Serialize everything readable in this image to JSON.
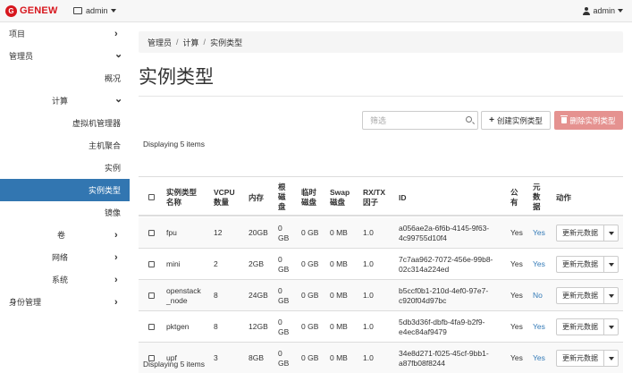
{
  "brand": {
    "name": "GENEW",
    "color": "#d7161d"
  },
  "topbar": {
    "project": "admin",
    "user": "admin"
  },
  "sidebar": {
    "items": [
      {
        "label": "项目",
        "chevron": "›"
      },
      {
        "label": "管理员",
        "chevron": "⌄"
      },
      {
        "label": "概况"
      },
      {
        "label": "计算",
        "chevron": "⌄"
      },
      {
        "label": "虚拟机管理器"
      },
      {
        "label": "主机聚合"
      },
      {
        "label": "实例"
      },
      {
        "label": "实例类型",
        "active": true
      },
      {
        "label": "镜像"
      },
      {
        "label": "卷",
        "chevron": "›"
      },
      {
        "label": "网络",
        "chevron": "›"
      },
      {
        "label": "系统",
        "chevron": "›"
      },
      {
        "label": "身份管理",
        "chevron": "›"
      }
    ]
  },
  "breadcrumb": [
    "管理员",
    "计算",
    "实例类型"
  ],
  "page_title": "实例类型",
  "toolbar": {
    "filter_placeholder": "筛选",
    "create_label": "创建实例类型",
    "delete_label": "删除实例类型"
  },
  "displaying": "Displaying 5 items",
  "table": {
    "columns": {
      "name": [
        "实例类型",
        "名称"
      ],
      "vcpu": [
        "VCPU",
        "数量"
      ],
      "ram": "内存",
      "root": [
        "根",
        "磁",
        "盘"
      ],
      "eph": [
        "临时",
        "磁盘"
      ],
      "swap": [
        "Swap",
        "磁盘"
      ],
      "rxtx": [
        "RX/TX",
        "因子"
      ],
      "id": "ID",
      "public": [
        "公",
        "有"
      ],
      "meta": [
        "元",
        "数",
        "据"
      ],
      "actions": "动作"
    },
    "rows": [
      {
        "name": [
          "fpu"
        ],
        "vcpu": "12",
        "ram": "20GB",
        "root": [
          "0",
          "GB"
        ],
        "eph": "0 GB",
        "swap": "0 MB",
        "rxtx": "1.0",
        "id": [
          "a056ae2a-6f6b-4145-9f63-",
          "4c99755d10f4"
        ],
        "public": "Yes",
        "meta": "Yes",
        "action": "更新元数据"
      },
      {
        "name": [
          "mini"
        ],
        "vcpu": "2",
        "ram": "2GB",
        "root": [
          "0",
          "GB"
        ],
        "eph": "0 GB",
        "swap": "0 MB",
        "rxtx": "1.0",
        "id": [
          "7c7aa962-7072-456e-99b8-",
          "02c314a224ed"
        ],
        "public": "Yes",
        "meta": "Yes",
        "action": "更新元数据"
      },
      {
        "name": [
          "openstack",
          "_node"
        ],
        "vcpu": "8",
        "ram": "24GB",
        "root": [
          "0",
          "GB"
        ],
        "eph": "0 GB",
        "swap": "0 MB",
        "rxtx": "1.0",
        "id": [
          "b5ccf0b1-210d-4ef0-97e7-",
          "c920f04d97bc"
        ],
        "public": "Yes",
        "meta": "No",
        "action": "更新元数据"
      },
      {
        "name": [
          "pktgen"
        ],
        "vcpu": "8",
        "ram": "12GB",
        "root": [
          "0",
          "GB"
        ],
        "eph": "0 GB",
        "swap": "0 MB",
        "rxtx": "1.0",
        "id": [
          "5db3d36f-dbfb-4fa9-b2f9-",
          "e4ec84af9479"
        ],
        "public": "Yes",
        "meta": "Yes",
        "action": "更新元数据"
      },
      {
        "name": [
          "upf"
        ],
        "vcpu": "3",
        "ram": "8GB",
        "root": [
          "0",
          "GB"
        ],
        "eph": "0 GB",
        "swap": "0 MB",
        "rxtx": "1.0",
        "id": [
          "34e8d271-f025-45cf-9bb1-",
          "a87fb08f8244"
        ],
        "public": "Yes",
        "meta": "Yes",
        "action": "更新元数据"
      }
    ]
  }
}
